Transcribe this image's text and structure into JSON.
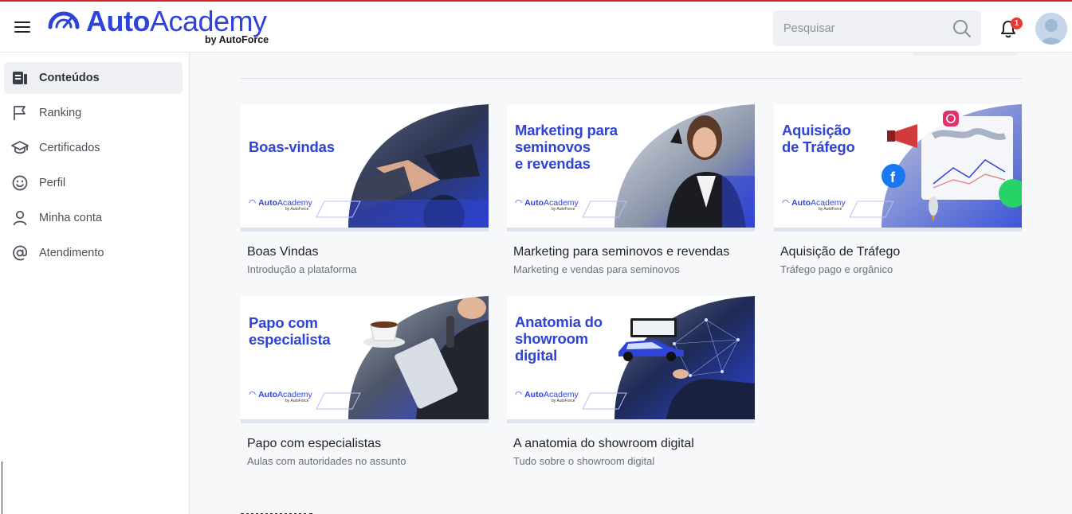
{
  "header": {
    "logo_bold": "Auto",
    "logo_light": "Academy",
    "logo_by": "by AutoForce",
    "search_placeholder": "Pesquisar",
    "notification_count": "1"
  },
  "sidebar": {
    "items": [
      {
        "label": "Conteúdos",
        "icon": "contents-icon",
        "active": true
      },
      {
        "label": "Ranking",
        "icon": "flag-icon",
        "active": false
      },
      {
        "label": "Certificados",
        "icon": "graduation-cap-icon",
        "active": false
      },
      {
        "label": "Perfil",
        "icon": "smile-icon",
        "active": false
      },
      {
        "label": "Minha conta",
        "icon": "user-icon",
        "active": false
      },
      {
        "label": "Atendimento",
        "icon": "at-sign-icon",
        "active": false
      }
    ]
  },
  "cards": [
    {
      "thumb_title": "Boas-vindas",
      "title": "Boas Vindas",
      "subtitle": "Introdução a plataforma",
      "brand_bold": "Auto",
      "brand_light": "Academy",
      "brand_by": "by AutoForce"
    },
    {
      "thumb_title": "Marketing para\nseminovos\ne revendas",
      "title": "Marketing para seminovos e revendas",
      "subtitle": "Marketing e vendas para seminovos",
      "brand_bold": "Auto",
      "brand_light": "Academy",
      "brand_by": "by AutoForce"
    },
    {
      "thumb_title": "Aquisição\nde Tráfego",
      "title": "Aquisição de Tráfego",
      "subtitle": "Tráfego pago e orgânico",
      "brand_bold": "Auto",
      "brand_light": "Academy",
      "brand_by": "by AutoForce"
    },
    {
      "thumb_title": "Papo com\nespecialista",
      "title": "Papo com especialistas",
      "subtitle": "Aulas com autoridades no assunto",
      "brand_bold": "Auto",
      "brand_light": "Academy",
      "brand_by": "by AutoForce"
    },
    {
      "thumb_title": "Anatomia do\nshowroom\ndigital",
      "title": "A anatomia do showroom digital",
      "subtitle": "Tudo sobre o showroom digital",
      "brand_bold": "Auto",
      "brand_light": "Academy",
      "brand_by": "by AutoForce"
    }
  ],
  "colors": {
    "brand_blue": "#2f43d6",
    "badge_red": "#e53935",
    "top_accent": "#c62828"
  }
}
